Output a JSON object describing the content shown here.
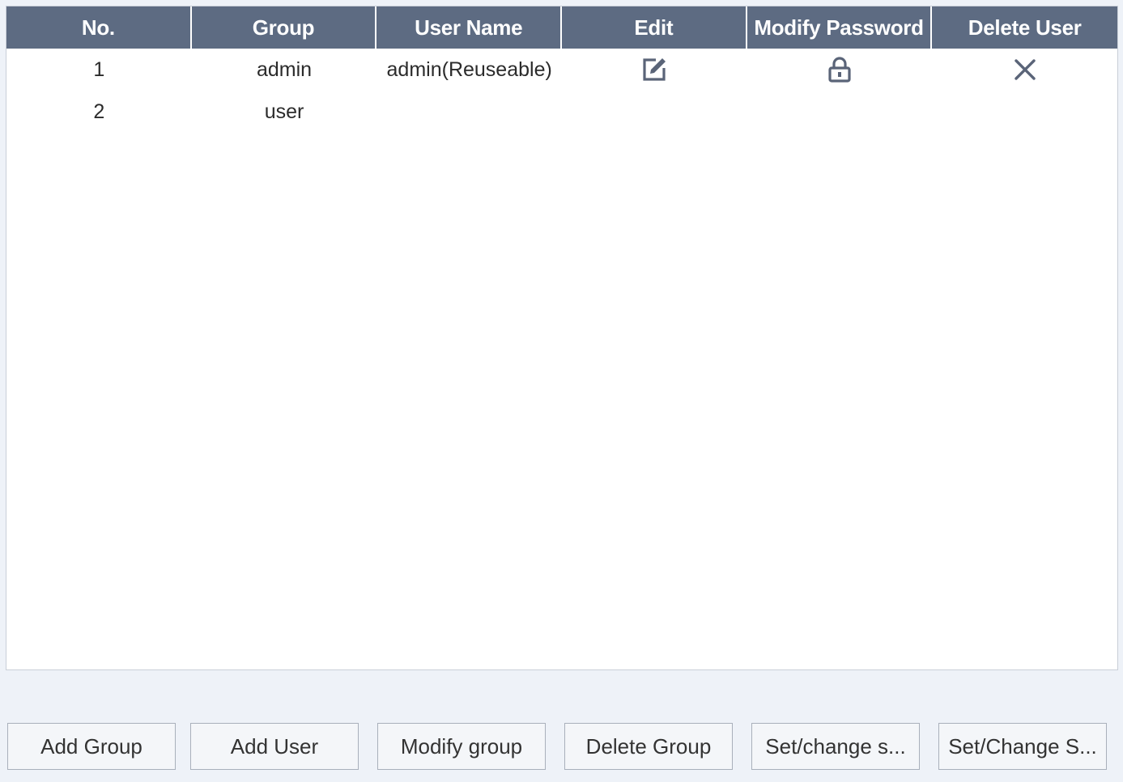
{
  "table": {
    "headers": [
      "No.",
      "Group",
      "User Name",
      "Edit",
      "Modify Password",
      "Delete User"
    ],
    "rows": [
      {
        "no": "1",
        "group": "admin",
        "user_name": "admin(Reuseable)",
        "edit_icon": "edit-icon",
        "password_icon": "lock-icon",
        "delete_icon": "close-icon"
      },
      {
        "no": "2",
        "group": "user",
        "user_name": "",
        "edit_icon": "",
        "password_icon": "",
        "delete_icon": ""
      }
    ]
  },
  "buttons": {
    "add_group": "Add Group",
    "add_user": "Add User",
    "modify_group": "Modify group",
    "delete_group": "Delete Group",
    "set_change_s1": "Set/change s...",
    "set_change_s2": "Set/Change S..."
  },
  "colors": {
    "header_bg": "#5d6b82",
    "header_text": "#ffffff",
    "icon_color": "#5a6478",
    "panel_bg": "#eef2f8"
  }
}
